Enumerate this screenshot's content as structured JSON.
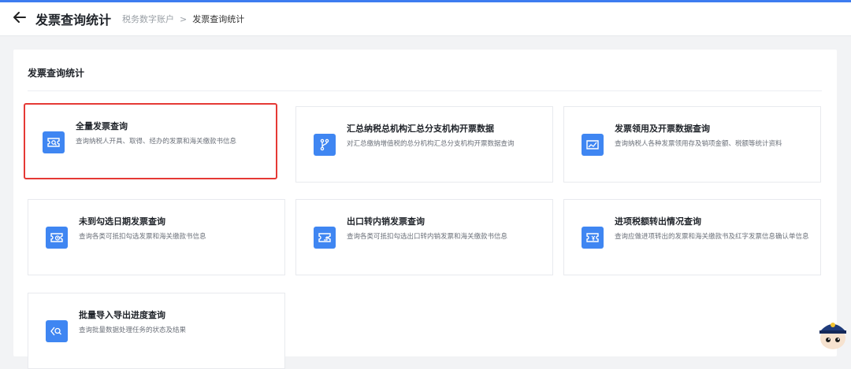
{
  "header": {
    "back_icon": "arrow-left-icon",
    "title": "发票查询统计",
    "breadcrumb": [
      "税务数字账户",
      "发票查询统计"
    ],
    "breadcrumb_separator": ">"
  },
  "panel": {
    "title": "发票查询统计"
  },
  "cards": [
    {
      "title": "全量发票查询",
      "desc": "查询纳税人开具、取得、经办的发票和海关缴款书信息",
      "icon": "ticket-search-icon",
      "highlighted": true
    },
    {
      "title": "汇总纳税总机构汇总分支机构开票数据",
      "desc": "对汇总缴纳增值税的总分机构汇总分支机构开票数据查询",
      "icon": "branch-icon"
    },
    {
      "title": "发票领用及开票数据查询",
      "desc": "查询纳税人各种发票领用存及销项金额、税额等统计资料",
      "icon": "trend-chart-icon"
    },
    {
      "title": "未到勾选日期发票查询",
      "desc": "查询各类可抵扣勾选发票和海关缴款书信息",
      "icon": "ticket-clock-icon"
    },
    {
      "title": "出口转内销发票查询",
      "desc": "查询各类可抵扣勾选出口转内销发票和海关缴款书信息",
      "icon": "ticket-return-icon"
    },
    {
      "title": "进项税额转出情况查询",
      "desc": "查询应做进项转出的发票和海关缴款书及红字发票信息确认单信息",
      "icon": "ticket-yen-icon"
    },
    {
      "title": "批量导入导出进度查询",
      "desc": "查询批量数据处理任务的状态及结果",
      "icon": "import-search-icon"
    }
  ],
  "colors": {
    "accent": "#3d7cf0",
    "icon_bg": "#3f86f2",
    "highlight_border": "#e53935"
  }
}
